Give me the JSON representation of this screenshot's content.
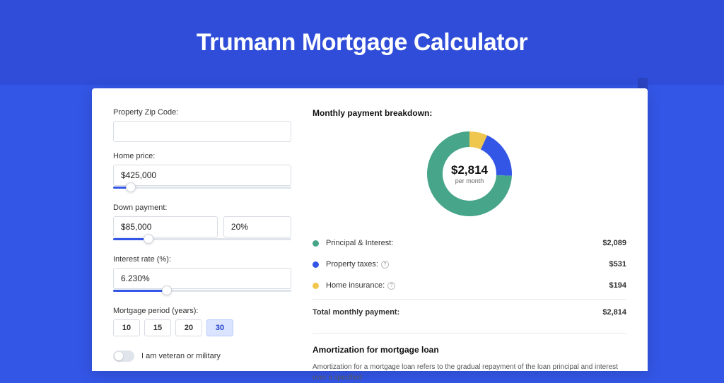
{
  "page_title": "Trumann Mortgage Calculator",
  "colors": {
    "accent": "#3356e6",
    "pi": "#47a58a",
    "tax": "#3356e6",
    "ins": "#f0c74e"
  },
  "form": {
    "zip_label": "Property Zip Code:",
    "zip_value": "",
    "home_price_label": "Home price:",
    "home_price_value": "$425,000",
    "home_price_pct": 10,
    "down_label": "Down payment:",
    "down_value": "$85,000",
    "down_pct_value": "20%",
    "down_slider_pct": 20,
    "rate_label": "Interest rate (%):",
    "rate_value": "6.230%",
    "rate_slider_pct": 30,
    "period_label": "Mortgage period (years):",
    "periods": [
      "10",
      "15",
      "20",
      "30"
    ],
    "period_selected": "30",
    "veteran_label": "I am veteran or military"
  },
  "breakdown": {
    "title": "Monthly payment breakdown:",
    "center_value": "$2,814",
    "center_sub": "per month",
    "items": [
      {
        "label": "Principal & Interest:",
        "value": "$2,089",
        "color": "#47a58a",
        "help": false
      },
      {
        "label": "Property taxes:",
        "value": "$531",
        "color": "#3356e6",
        "help": true
      },
      {
        "label": "Home insurance:",
        "value": "$194",
        "color": "#f0c74e",
        "help": true
      }
    ],
    "total_label": "Total monthly payment:",
    "total_value": "$2,814"
  },
  "chart_data": {
    "type": "pie",
    "title": "Monthly payment breakdown",
    "series": [
      {
        "name": "Principal & Interest",
        "value": 2089,
        "color": "#47a58a"
      },
      {
        "name": "Property taxes",
        "value": 531,
        "color": "#3356e6"
      },
      {
        "name": "Home insurance",
        "value": 194,
        "color": "#f0c74e"
      }
    ],
    "total": 2814,
    "center_label": "$2,814 per month"
  },
  "amortization": {
    "title": "Amortization for mortgage loan",
    "text": "Amortization for a mortgage loan refers to the gradual repayment of the loan principal and interest over a specified"
  }
}
